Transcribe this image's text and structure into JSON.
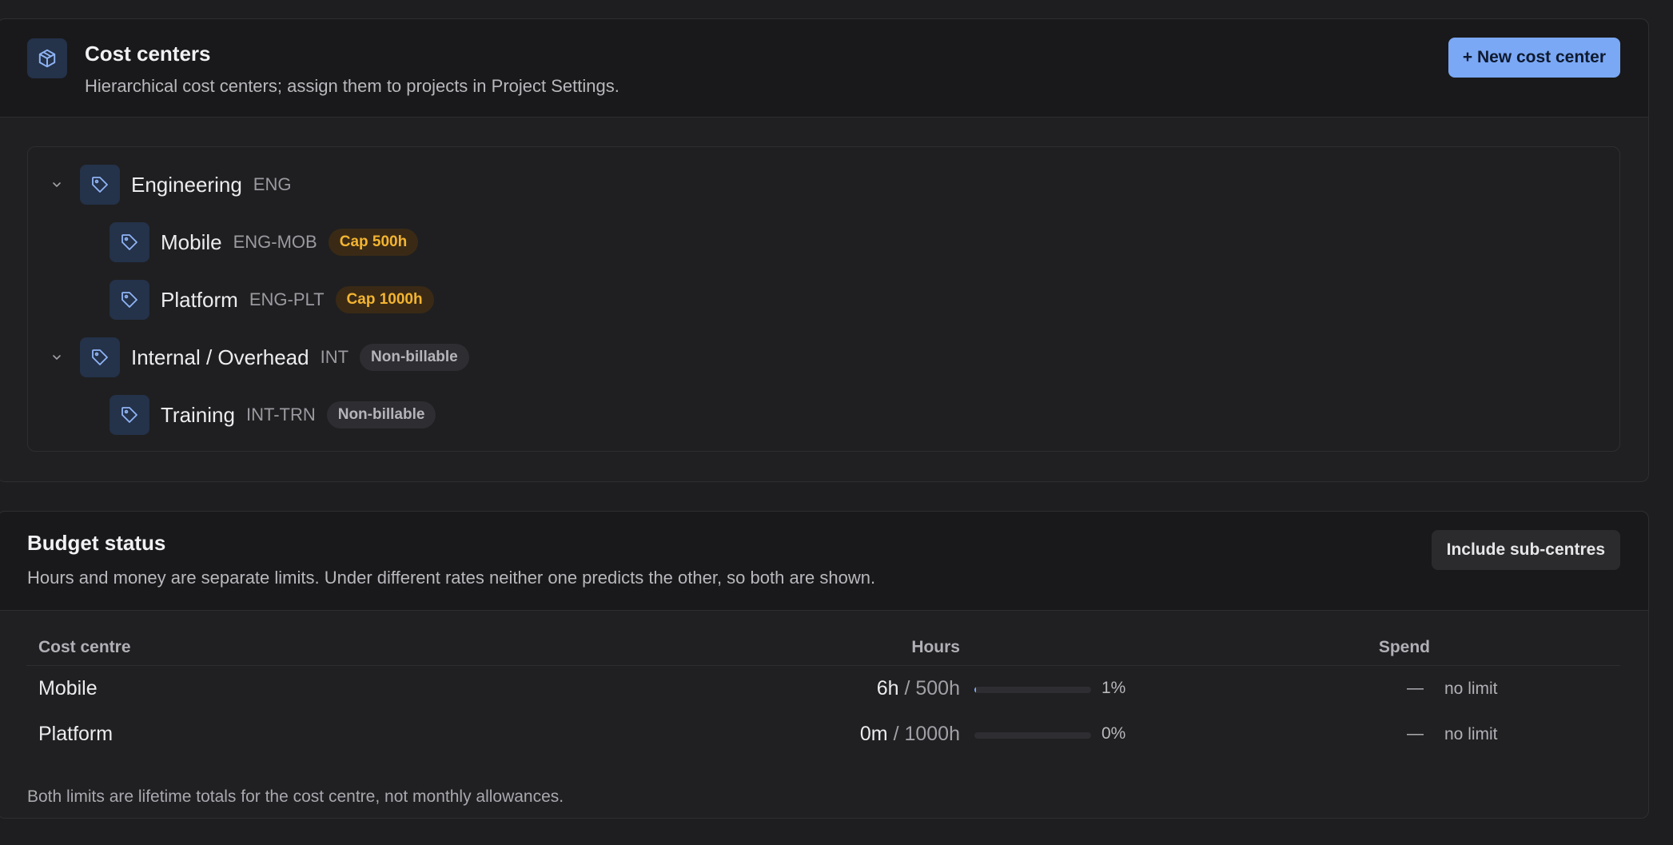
{
  "cost_centers": {
    "title": "Cost centers",
    "subtitle": "Hierarchical cost centers; assign them to projects in Project Settings.",
    "header_icon": "box-icon",
    "new_button_label": "+ New cost center",
    "tree": [
      {
        "name": "Engineering",
        "code": "ENG",
        "level": 0,
        "expanded": true,
        "badge": null
      },
      {
        "name": "Mobile",
        "code": "ENG-MOB",
        "level": 1,
        "badge": "Cap 500h",
        "badge_type": "cap"
      },
      {
        "name": "Platform",
        "code": "ENG-PLT",
        "level": 1,
        "badge": "Cap 1000h",
        "badge_type": "cap"
      },
      {
        "name": "Internal / Overhead",
        "code": "INT",
        "level": 0,
        "expanded": true,
        "badge": "Non-billable",
        "badge_type": "nonbillable"
      },
      {
        "name": "Training",
        "code": "INT-TRN",
        "level": 1,
        "badge": "Non-billable",
        "badge_type": "nonbillable"
      }
    ]
  },
  "budget": {
    "title": "Budget status",
    "subtitle": "Hours and money are separate limits. Under different rates neither one predicts the other, so both are shown.",
    "include_button_label": "Include sub-centres",
    "columns": {
      "name": "Cost centre",
      "hours": "Hours",
      "spend": "Spend"
    },
    "rows": [
      {
        "name": "Mobile",
        "used": "6h",
        "total": "/ 500h",
        "progress": 0.012,
        "pct": "1%",
        "spend": "—",
        "limit": "no limit"
      },
      {
        "name": "Platform",
        "used": "0m",
        "total": "/ 1000h",
        "progress": 0,
        "pct": "0%",
        "spend": "—",
        "limit": "no limit"
      }
    ],
    "footnote": "Both limits are lifetime totals for the cost centre, not monthly allowances."
  },
  "colors": {
    "accent": "#7aa8f5",
    "cap_badge_text": "#f3b431",
    "cap_badge_bg": "#3a2a15",
    "icon_tile_bg": "#24324a"
  }
}
